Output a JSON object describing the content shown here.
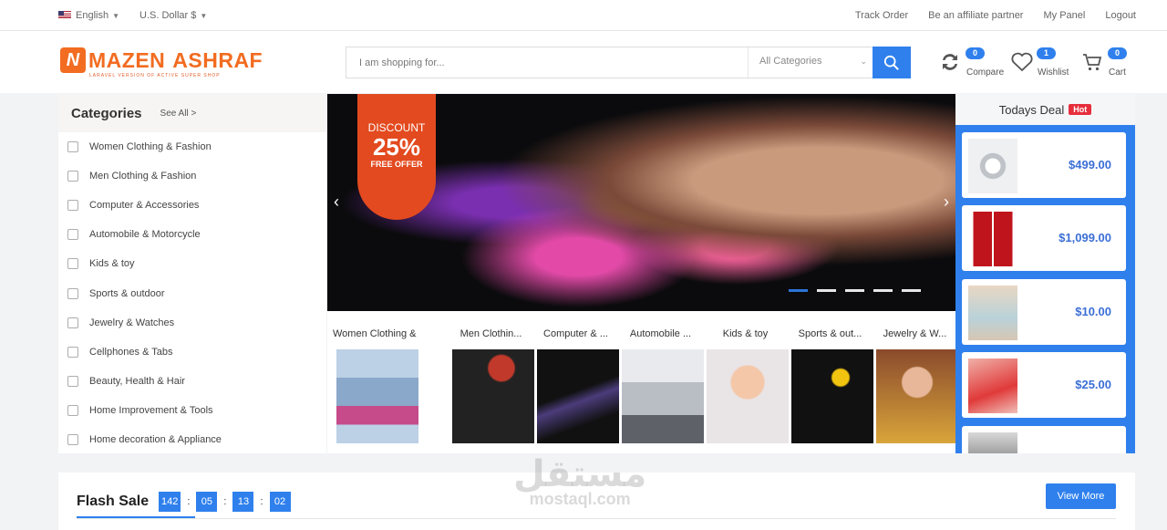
{
  "topbar": {
    "language": "English",
    "currency": "U.S. Dollar $",
    "links": [
      "Track Order",
      "Be an affiliate partner",
      "My Panel",
      "Logout"
    ]
  },
  "header": {
    "logo_mark": "N",
    "logo_word1": "MAZEN",
    "logo_word2": "ASHRAF",
    "logo_tagline": "LARAVEL VERSION OF ACTIVE SUPER SHOP",
    "search_placeholder": "I am shopping for...",
    "category_select": "All Categories",
    "compare_label": "Compare",
    "compare_count": "0",
    "wishlist_label": "Wishlist",
    "wishlist_count": "1",
    "cart_label": "Cart",
    "cart_count": "0"
  },
  "categories": {
    "title": "Categories",
    "see_all": "See All >",
    "items": [
      "Women Clothing & Fashion",
      "Men Clothing & Fashion",
      "Computer & Accessories",
      "Automobile & Motorcycle",
      "Kids & toy",
      "Sports & outdoor",
      "Jewelry & Watches",
      "Cellphones & Tabs",
      "Beauty, Health & Hair",
      "Home Improvement & Tools",
      "Home decoration & Appliance"
    ]
  },
  "banner": {
    "discount_line1": "DISCOUNT",
    "discount_value": "25%",
    "discount_line3": "FREE OFFER",
    "prev": "‹",
    "next": "›"
  },
  "thumbs": [
    "Women Clothing & F...",
    "Men Clothin...",
    "Computer & ...",
    "Automobile ...",
    "Kids & toy",
    "Sports & out...",
    "Jewelry & W..."
  ],
  "deal": {
    "title": "Todays Deal",
    "hot": "Hot",
    "prices": [
      "$499.00",
      "$1,099.00",
      "$10.00",
      "$25.00"
    ]
  },
  "flash": {
    "title": "Flash Sale",
    "days": "142",
    "hours": "05",
    "minutes": "13",
    "seconds": "02",
    "view_more": "View More"
  },
  "watermark": {
    "arabic": "مستقل",
    "latin": "mostaql.com"
  },
  "colors": {
    "accent": "#2f80ed",
    "brand": "#f26c21",
    "hot": "#e62e3c"
  }
}
